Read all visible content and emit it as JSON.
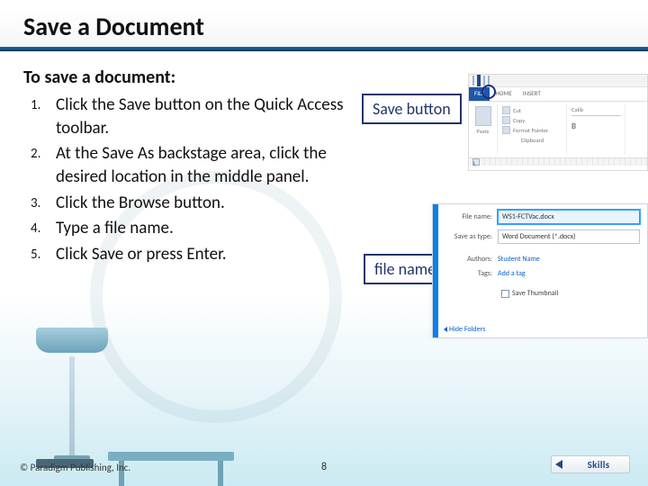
{
  "title": "Save a Document",
  "intro": "To save a document:",
  "steps": [
    "Click the Save button on the Quick Access toolbar.",
    "At the Save As backstage area, click the desired location in the middle panel.",
    "Click the Browse button.",
    "Type a file name.",
    "Click Save or press Enter."
  ],
  "callouts": {
    "save": "Save button",
    "filename": "file name"
  },
  "word_ui": {
    "tabs": {
      "file": "FILE",
      "home": "HOME",
      "insert": "INSERT"
    },
    "ribbon": {
      "paste": "Paste",
      "cut": "Cut",
      "copy": "Copy",
      "painter": "Format Painter",
      "clipboard": "Clipboard",
      "font": "Calib",
      "bold": "B"
    },
    "ruler_mark": "L"
  },
  "save_dialog": {
    "filename_label": "File name:",
    "filename_value": "WS1-FCTVac.docx",
    "type_label": "Save as type:",
    "type_value": "Word Document (*.docx)",
    "authors_label": "Authors:",
    "authors_value": "Student Name",
    "tags_label": "Tags:",
    "tags_value": "Add a tag",
    "thumbnail": "Save Thumbnail",
    "hide_folders": "Hide Folders"
  },
  "footer": {
    "copyright": "© Paradigm Publishing, Inc.",
    "page": "8",
    "skills": "Skills"
  }
}
